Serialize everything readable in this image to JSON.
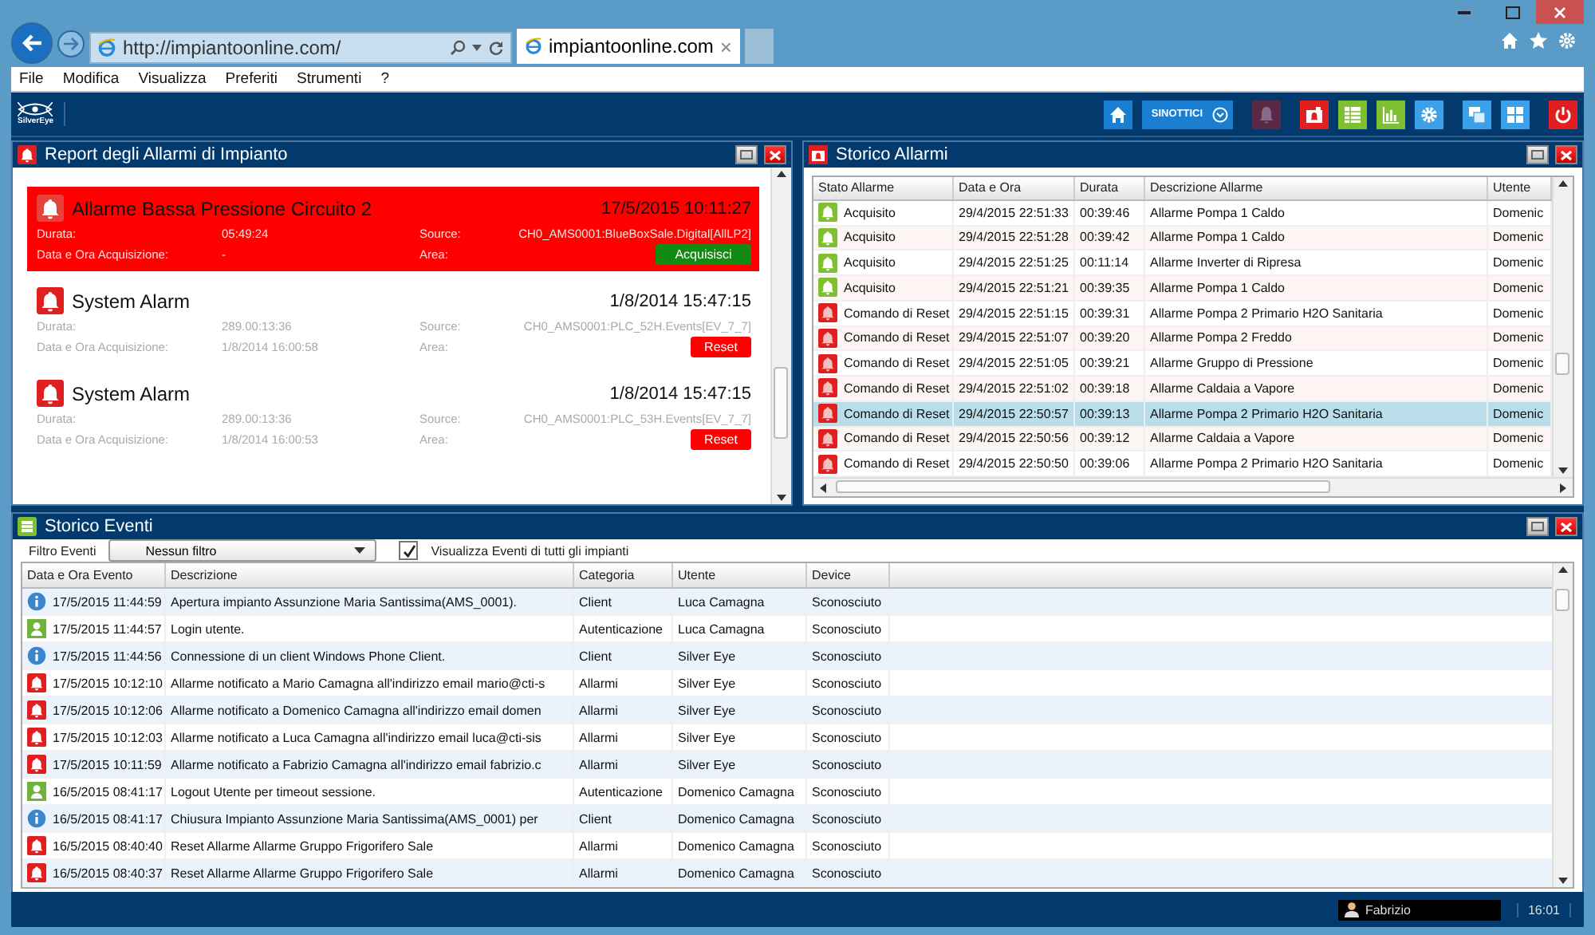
{
  "browser": {
    "url": "http://impiantoonline.com/",
    "tab_title": "impiantoonline.com",
    "tab_close": "×"
  },
  "menu": [
    "File",
    "Modifica",
    "Visualizza",
    "Preferiti",
    "Strumenti",
    "?"
  ],
  "app_bar": {
    "logo": "SilverEye",
    "buttons": [
      {
        "kind": "home",
        "color": "#1a7fd0"
      },
      {
        "kind": "dropdown",
        "label": "SINOTTICI",
        "color": "#1a7fd0"
      },
      {
        "kind": "bell",
        "color": "#5a2a45"
      },
      {
        "kind": "alarm",
        "color": "#e02020"
      },
      {
        "kind": "table",
        "color": "#7fc031"
      },
      {
        "kind": "chart",
        "color": "#7fc031"
      },
      {
        "kind": "gear",
        "color": "#3aa0e8"
      },
      {
        "kind": "windows",
        "color": "#3aa0e8"
      },
      {
        "kind": "grid",
        "color": "#3aa0e8"
      },
      {
        "kind": "power",
        "color": "#e02020"
      }
    ]
  },
  "report": {
    "title": "Report degli Allarmi di Impianto",
    "alarms": [
      {
        "title": "Allarme Bassa Pressione Circuito 2",
        "time": "17/5/2015 10:11:27",
        "active": true,
        "duration_label": "Durata:",
        "duration": "05:49:24",
        "ack_label": "Data e Ora Acquisizione:",
        "ack": "-",
        "source_label": "Source:",
        "source": "CH0_AMS0001:BlueBoxSale.Digital[AllLP2]",
        "area_label": "Area:",
        "button": {
          "kind": "acquire",
          "label": "Acquisisci"
        }
      },
      {
        "title": "System Alarm",
        "time": "1/8/2014 15:47:15",
        "active": false,
        "duration_label": "Durata:",
        "duration": "289.00:13:36",
        "ack_label": "Data e Ora Acquisizione:",
        "ack": "1/8/2014 16:00:58",
        "source_label": "Source:",
        "source": "CH0_AMS0001:PLC_52H.Events[EV_7_7]",
        "area_label": "Area:",
        "button": {
          "kind": "reset",
          "label": "Reset"
        }
      },
      {
        "title": "System Alarm",
        "time": "1/8/2014 15:47:15",
        "active": false,
        "duration_label": "Durata:",
        "duration": "289.00:13:36",
        "ack_label": "Data e Ora Acquisizione:",
        "ack": "1/8/2014 16:00:53",
        "source_label": "Source:",
        "source": "CH0_AMS0001:PLC_53H.Events[EV_7_7]",
        "area_label": "Area:",
        "button": {
          "kind": "reset",
          "label": "Reset"
        }
      }
    ]
  },
  "alarm_history": {
    "title": "Storico Allarmi",
    "columns": [
      "Stato Allarme",
      "Data e Ora",
      "Durata",
      "Descrizione Allarme",
      "Utente"
    ],
    "rows": [
      {
        "kind": "acquired",
        "state": "Acquisito",
        "time": "29/4/2015 22:51:33",
        "duration": "00:39:46",
        "description": "Allarme Pompa 1 Caldo",
        "user": "Domenic",
        "selected": false
      },
      {
        "kind": "acquired",
        "state": "Acquisito",
        "time": "29/4/2015 22:51:28",
        "duration": "00:39:42",
        "description": "Allarme Pompa 1 Caldo",
        "user": "Domenic",
        "selected": false
      },
      {
        "kind": "acquired",
        "state": "Acquisito",
        "time": "29/4/2015 22:51:25",
        "duration": "00:11:14",
        "description": "Allarme Inverter di Ripresa",
        "user": "Domenic",
        "selected": false
      },
      {
        "kind": "acquired",
        "state": "Acquisito",
        "time": "29/4/2015 22:51:21",
        "duration": "00:39:35",
        "description": "Allarme Pompa 1 Caldo",
        "user": "Domenic",
        "selected": false
      },
      {
        "kind": "reset",
        "state": "Comando di Reset",
        "time": "29/4/2015 22:51:15",
        "duration": "00:39:31",
        "description": "Allarme Pompa 2 Primario H2O Sanitaria",
        "user": "Domenic",
        "selected": false
      },
      {
        "kind": "reset",
        "state": "Comando di Reset",
        "time": "29/4/2015 22:51:07",
        "duration": "00:39:20",
        "description": "Allarme Pompa 2 Freddo",
        "user": "Domenic",
        "selected": false
      },
      {
        "kind": "reset",
        "state": "Comando di Reset",
        "time": "29/4/2015 22:51:05",
        "duration": "00:39:21",
        "description": "Allarme Gruppo di Pressione",
        "user": "Domenic",
        "selected": false
      },
      {
        "kind": "reset",
        "state": "Comando di Reset",
        "time": "29/4/2015 22:51:02",
        "duration": "00:39:18",
        "description": "Allarme Caldaia a Vapore",
        "user": "Domenic",
        "selected": false
      },
      {
        "kind": "reset",
        "state": "Comando di Reset",
        "time": "29/4/2015 22:50:57",
        "duration": "00:39:13",
        "description": "Allarme Pompa 2 Primario H2O Sanitaria",
        "user": "Domenic",
        "selected": true
      },
      {
        "kind": "reset",
        "state": "Comando di Reset",
        "time": "29/4/2015 22:50:56",
        "duration": "00:39:12",
        "description": "Allarme Caldaia a Vapore",
        "user": "Domenic",
        "selected": false
      },
      {
        "kind": "reset",
        "state": "Comando di Reset",
        "time": "29/4/2015 22:50:50",
        "duration": "00:39:06",
        "description": "Allarme Pompa 2 Primario H2O Sanitaria",
        "user": "Domenic",
        "selected": false
      }
    ]
  },
  "event_history": {
    "title": "Storico Eventi",
    "filter_label": "Filtro Eventi",
    "filter_value": "Nessun filtro",
    "show_all": {
      "label": "Visualizza Eventi di tutti gli impianti",
      "checked": true
    },
    "columns": [
      "Data e Ora Evento",
      "Descrizione",
      "Categoria",
      "Utente",
      "Device"
    ],
    "rows": [
      {
        "kind": "info",
        "time": "17/5/2015 11:44:59",
        "description": "Apertura impianto Assunzione Maria Santissima(AMS_0001).",
        "category": "Client",
        "user": "Luca Camagna",
        "device": "Sconosciuto"
      },
      {
        "kind": "user",
        "time": "17/5/2015 11:44:57",
        "description": "Login utente.",
        "category": "Autenticazione",
        "user": "Luca Camagna",
        "device": "Sconosciuto"
      },
      {
        "kind": "info",
        "time": "17/5/2015 11:44:56",
        "description": "Connessione di un client Windows Phone Client.",
        "category": "Client",
        "user": "Silver Eye",
        "device": "Sconosciuto"
      },
      {
        "kind": "alarm",
        "time": "17/5/2015 10:12:10",
        "description": "Allarme notificato a Mario Camagna all'indirizzo email mario@cti-s",
        "category": "Allarmi",
        "user": "Silver Eye",
        "device": "Sconosciuto"
      },
      {
        "kind": "alarm",
        "time": "17/5/2015 10:12:06",
        "description": "Allarme notificato a Domenico Camagna all'indirizzo email domen",
        "category": "Allarmi",
        "user": "Silver Eye",
        "device": "Sconosciuto"
      },
      {
        "kind": "alarm",
        "time": "17/5/2015 10:12:03",
        "description": "Allarme notificato a Luca Camagna all'indirizzo email luca@cti-sis",
        "category": "Allarmi",
        "user": "Silver Eye",
        "device": "Sconosciuto"
      },
      {
        "kind": "alarm",
        "time": "17/5/2015 10:11:59",
        "description": "Allarme notificato a Fabrizio Camagna all'indirizzo email fabrizio.c",
        "category": "Allarmi",
        "user": "Silver Eye",
        "device": "Sconosciuto"
      },
      {
        "kind": "user",
        "time": "16/5/2015 08:41:17",
        "description": "Logout Utente per timeout sessione.",
        "category": "Autenticazione",
        "user": "Domenico Camagna",
        "device": "Sconosciuto"
      },
      {
        "kind": "info",
        "time": "16/5/2015 08:41:17",
        "description": "Chiusura Impianto Assunzione Maria Santissima(AMS_0001) per",
        "category": "Client",
        "user": "Domenico Camagna",
        "device": "Sconosciuto"
      },
      {
        "kind": "alarm",
        "time": "16/5/2015 08:40:40",
        "description": "Reset Allarme Allarme Gruppo Frigorifero Sale",
        "category": "Allarmi",
        "user": "Domenico Camagna",
        "device": "Sconosciuto"
      },
      {
        "kind": "alarm",
        "time": "16/5/2015 08:40:37",
        "description": "Reset Allarme Allarme Gruppo Frigorifero Sale",
        "category": "Allarmi",
        "user": "Domenico Camagna",
        "device": "Sconosciuto"
      }
    ]
  },
  "status_bar": {
    "user": "Fabrizio",
    "time": "16:01"
  }
}
